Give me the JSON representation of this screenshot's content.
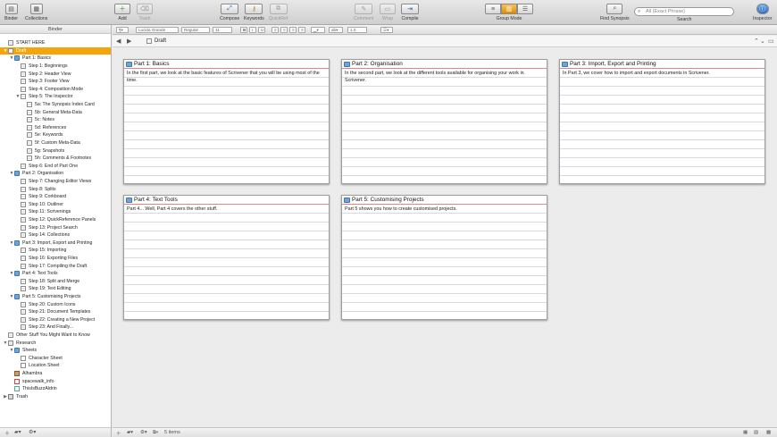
{
  "toolbar": {
    "buttons": [
      {
        "label": "Binder",
        "glyph": "▤"
      },
      {
        "label": "Collections",
        "glyph": "▦"
      },
      {
        "label": "Add",
        "glyph": "＋"
      },
      {
        "label": "Trash",
        "glyph": "⌫"
      },
      {
        "label": "Compose",
        "glyph": "⤢"
      },
      {
        "label": "Keywords",
        "glyph": "⚷"
      },
      {
        "label": "QuickRef",
        "glyph": "⧉"
      },
      {
        "label": "Comment",
        "glyph": "✎"
      },
      {
        "label": "Wrap",
        "glyph": "▭"
      },
      {
        "label": "Compile",
        "glyph": "⇥"
      },
      {
        "label": "Group Mode",
        "glyph": "▥"
      },
      {
        "label": "Find Synopsis",
        "glyph": "⌕"
      },
      {
        "label": "Inspector",
        "glyph": "ⓘ"
      }
    ],
    "search": {
      "placeholder": "All (Exact Phrase)",
      "label": "Search"
    }
  },
  "binder": {
    "header": "Binder",
    "items": [
      {
        "label": "START HERE",
        "indent": 0,
        "icon": "doc-text",
        "disclosure": ""
      },
      {
        "label": "Draft",
        "indent": 0,
        "icon": "draft",
        "disclosure": "▼",
        "selected": true
      },
      {
        "label": "Part 1: Basics",
        "indent": 1,
        "icon": "folder",
        "disclosure": "▼"
      },
      {
        "label": "Step 1: Beginnings",
        "indent": 2,
        "icon": "doc-text",
        "disclosure": ""
      },
      {
        "label": "Step 2: Header View",
        "indent": 2,
        "icon": "doc-text",
        "disclosure": ""
      },
      {
        "label": "Step 3: Footer View",
        "indent": 2,
        "icon": "doc-text",
        "disclosure": ""
      },
      {
        "label": "Step 4: Composition Mode",
        "indent": 2,
        "icon": "doc-text",
        "disclosure": ""
      },
      {
        "label": "Step 5: The Inspector",
        "indent": 2,
        "icon": "doc-text",
        "disclosure": "▼"
      },
      {
        "label": "5a: The Synopsis Index Card",
        "indent": 3,
        "icon": "doc-text",
        "disclosure": ""
      },
      {
        "label": "5b: General Meta-Data",
        "indent": 3,
        "icon": "doc-text",
        "disclosure": ""
      },
      {
        "label": "5c: Notes",
        "indent": 3,
        "icon": "doc-text",
        "disclosure": ""
      },
      {
        "label": "5d: References",
        "indent": 3,
        "icon": "doc-text",
        "disclosure": ""
      },
      {
        "label": "5e: Keywords",
        "indent": 3,
        "icon": "doc-text",
        "disclosure": ""
      },
      {
        "label": "5f: Custom Meta-Data",
        "indent": 3,
        "icon": "doc-text",
        "disclosure": ""
      },
      {
        "label": "5g: Snapshots",
        "indent": 3,
        "icon": "doc-text",
        "disclosure": ""
      },
      {
        "label": "5h: Comments & Footnotes",
        "indent": 3,
        "icon": "doc-text",
        "disclosure": ""
      },
      {
        "label": "Step 6: End of Part One",
        "indent": 2,
        "icon": "doc-text",
        "disclosure": ""
      },
      {
        "label": "Part 2: Organisation",
        "indent": 1,
        "icon": "folder",
        "disclosure": "▼"
      },
      {
        "label": "Step 7: Changing Editor Views",
        "indent": 2,
        "icon": "doc-text",
        "disclosure": ""
      },
      {
        "label": "Step 8: Splits",
        "indent": 2,
        "icon": "doc-text",
        "disclosure": ""
      },
      {
        "label": "Step 9: Corkboard",
        "indent": 2,
        "icon": "doc-text",
        "disclosure": ""
      },
      {
        "label": "Step 10: Outliner",
        "indent": 2,
        "icon": "doc-text",
        "disclosure": ""
      },
      {
        "label": "Step 11: Scrivenings",
        "indent": 2,
        "icon": "doc-text",
        "disclosure": ""
      },
      {
        "label": "Step 12: QuickReference Panels",
        "indent": 2,
        "icon": "doc-text",
        "disclosure": ""
      },
      {
        "label": "Step 13: Project Search",
        "indent": 2,
        "icon": "doc-text",
        "disclosure": ""
      },
      {
        "label": "Step 14: Collections",
        "indent": 2,
        "icon": "doc-text",
        "disclosure": ""
      },
      {
        "label": "Part 3: Import, Export and Printing",
        "indent": 1,
        "icon": "folder",
        "disclosure": "▼"
      },
      {
        "label": "Step 15: Importing",
        "indent": 2,
        "icon": "doc-text",
        "disclosure": ""
      },
      {
        "label": "Step 16: Exporting Files",
        "indent": 2,
        "icon": "doc-text",
        "disclosure": ""
      },
      {
        "label": "Step 17: Compiling the Draft",
        "indent": 2,
        "icon": "doc-text",
        "disclosure": ""
      },
      {
        "label": "Part 4: Text Tools",
        "indent": 1,
        "icon": "folder",
        "disclosure": "▼"
      },
      {
        "label": "Step 18: Split and Merge",
        "indent": 2,
        "icon": "doc-text",
        "disclosure": ""
      },
      {
        "label": "Step 19: Text Editing",
        "indent": 2,
        "icon": "doc-text",
        "disclosure": ""
      },
      {
        "label": "Part 5: Customising Projects",
        "indent": 1,
        "icon": "folder",
        "disclosure": "▼"
      },
      {
        "label": "Step 20: Custom Icons",
        "indent": 2,
        "icon": "doc-text",
        "disclosure": ""
      },
      {
        "label": "Step 21: Document Templates",
        "indent": 2,
        "icon": "doc-text",
        "disclosure": ""
      },
      {
        "label": "Step 22: Creating a New Project",
        "indent": 2,
        "icon": "doc-text",
        "disclosure": ""
      },
      {
        "label": "Step 23: And Finally...",
        "indent": 2,
        "icon": "doc-text",
        "disclosure": ""
      },
      {
        "label": "Other Stuff You Might Want to Know",
        "indent": 0,
        "icon": "doc-text",
        "disclosure": ""
      },
      {
        "label": "Research",
        "indent": 0,
        "icon": "research",
        "disclosure": "▼"
      },
      {
        "label": "Sheets",
        "indent": 1,
        "icon": "folder",
        "disclosure": "▼"
      },
      {
        "label": "Character Sheet",
        "indent": 2,
        "icon": "doc",
        "disclosure": ""
      },
      {
        "label": "Location Sheet",
        "indent": 2,
        "icon": "doc",
        "disclosure": ""
      },
      {
        "label": "Alhambra",
        "indent": 1,
        "icon": "img",
        "disclosure": ""
      },
      {
        "label": "spacewalk_info",
        "indent": 1,
        "icon": "pdf",
        "disclosure": ""
      },
      {
        "label": "ThisIsBuzzAldrin",
        "indent": 1,
        "icon": "web",
        "disclosure": ""
      },
      {
        "label": "Trash",
        "indent": 0,
        "icon": "trash",
        "disclosure": "▶"
      }
    ]
  },
  "formatbar": {
    "font": "Lucida Grande",
    "style": "Regular",
    "size": "11",
    "bold": "B",
    "italic": "I",
    "underline": "U",
    "line_spacing": "1.0"
  },
  "header": {
    "title": "Draft"
  },
  "cards": [
    {
      "title": "Part 1: Basics",
      "synopsis": "In the first part, we look at the basic features of Scrivener that you will be using most of the time."
    },
    {
      "title": "Part 2: Organisation",
      "synopsis": "In the second part, we look at the different tools available for organising your work in Scrivener."
    },
    {
      "title": "Part 3: Import, Export and Printing",
      "synopsis": "In Part 3, we cover how to import and export documents in Scrivener."
    },
    {
      "title": "Part 4: Text Tools",
      "synopsis": "Part 4... Well, Part 4 covers the other stuff."
    },
    {
      "title": "Part 5: Customising Projects",
      "synopsis": "Part 5 shows you how to create customised projects."
    }
  ],
  "footer": {
    "count": "5 items"
  },
  "colors": {
    "selection": "#f5a40a",
    "card_title_rule": "#d48a8a",
    "folder": "#6fa3d9"
  }
}
